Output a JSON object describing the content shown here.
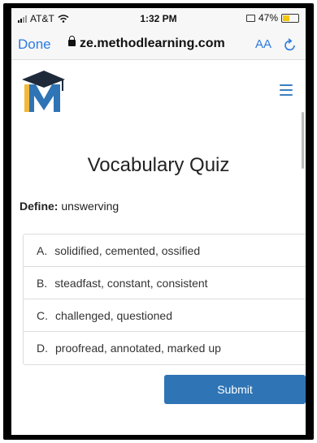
{
  "status_bar": {
    "carrier": "AT&T",
    "time": "1:32 PM",
    "battery": "47%",
    "battery_level": 0.47
  },
  "browser": {
    "done_label": "Done",
    "url": "ze.methodlearning.com",
    "text_size_label": "AA",
    "reload_icon": "reload-icon"
  },
  "site": {
    "logo_letter": "M",
    "logo_icon": "graduation-cap-logo",
    "menu_icon": "hamburger-icon"
  },
  "quiz": {
    "title": "Vocabulary Quiz",
    "define_label": "Define:",
    "word": "unswerving",
    "options": [
      {
        "letter": "A.",
        "text": "solidified, cemented, ossified"
      },
      {
        "letter": "B.",
        "text": "steadfast, constant, consistent"
      },
      {
        "letter": "C.",
        "text": "challenged, questioned"
      },
      {
        "letter": "D.",
        "text": "proofread, annotated, marked up"
      }
    ],
    "submit_label": "Submit"
  },
  "colors": {
    "accent": "#2f74b5",
    "ios_blue": "#2a7ae2",
    "logo_yellow": "#f2b83a",
    "logo_blue": "#2f74b5"
  }
}
